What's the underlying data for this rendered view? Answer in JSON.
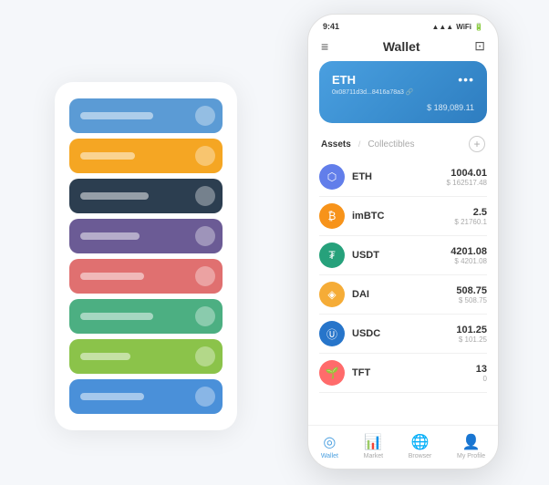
{
  "cardStack": {
    "items": [
      {
        "color": "card-blue",
        "lineWidth": "80px"
      },
      {
        "color": "card-orange",
        "lineWidth": "60px"
      },
      {
        "color": "card-dark",
        "lineWidth": "75px"
      },
      {
        "color": "card-purple",
        "lineWidth": "65px"
      },
      {
        "color": "card-red",
        "lineWidth": "70px"
      },
      {
        "color": "card-green",
        "lineWidth": "80px"
      },
      {
        "color": "card-light-green",
        "lineWidth": "55px"
      },
      {
        "color": "card-blue2",
        "lineWidth": "70px"
      }
    ]
  },
  "statusBar": {
    "time": "9:41",
    "signal": "▲▲▲",
    "wifi": "WiFi",
    "battery": "🔋"
  },
  "header": {
    "menu_icon": "≡",
    "title": "Wallet",
    "expand_icon": "⊡"
  },
  "ethCard": {
    "title": "ETH",
    "dots": "•••",
    "address": "0x08711d3d...8416a78a3 🔗",
    "currency": "$",
    "balance": "189,089.11"
  },
  "assetsSection": {
    "tab_active": "Assets",
    "divider": "/",
    "tab_inactive": "Collectibles",
    "add_label": "+"
  },
  "assets": [
    {
      "name": "ETH",
      "amount": "1004.01",
      "usd": "$ 162517.48",
      "icon": "⬡",
      "icon_class": "icon-eth"
    },
    {
      "name": "imBTC",
      "amount": "2.5",
      "usd": "$ 21760.1",
      "icon": "₿",
      "icon_class": "icon-imbtc"
    },
    {
      "name": "USDT",
      "amount": "4201.08",
      "usd": "$ 4201.08",
      "icon": "₮",
      "icon_class": "icon-usdt"
    },
    {
      "name": "DAI",
      "amount": "508.75",
      "usd": "$ 508.75",
      "icon": "◈",
      "icon_class": "icon-dai"
    },
    {
      "name": "USDC",
      "amount": "101.25",
      "usd": "$ 101.25",
      "icon": "Ⓤ",
      "icon_class": "icon-usdc"
    },
    {
      "name": "TFT",
      "amount": "13",
      "usd": "0",
      "icon": "🌱",
      "icon_class": "icon-tft"
    }
  ],
  "bottomNav": [
    {
      "label": "Wallet",
      "icon": "◎",
      "active": true
    },
    {
      "label": "Market",
      "icon": "📊",
      "active": false
    },
    {
      "label": "Browser",
      "icon": "🌐",
      "active": false
    },
    {
      "label": "My Profile",
      "icon": "👤",
      "active": false
    }
  ]
}
